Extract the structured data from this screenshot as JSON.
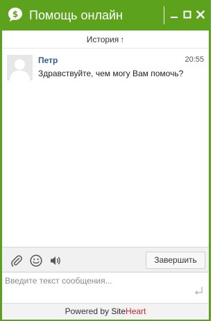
{
  "window": {
    "title": "Помощь онлайн"
  },
  "titlebar": {
    "minimize_icon": "minimize-icon",
    "maximize_icon": "maximize-icon",
    "close_icon": "close-icon",
    "logo_icon": "chat-bubble-dollar-icon"
  },
  "history": {
    "label": "История",
    "arrow": "↑"
  },
  "messages": [
    {
      "author": "Петр",
      "time": "20:55",
      "text": "Здравствуйте, чем могу Вам помочь?",
      "avatar_icon": "user-silhouette-icon"
    }
  ],
  "toolbar": {
    "icons": [
      "paperclip-icon",
      "smiley-icon",
      "speaker-icon"
    ],
    "end_label": "Завершить"
  },
  "input": {
    "placeholder": "Введите текст сообщения...",
    "value": "",
    "send_icon": "enter-icon"
  },
  "footer": {
    "prefix": "Powered by",
    "brand_part1": "Site",
    "brand_part2": "Heart"
  },
  "colors": {
    "accent": "#5ca21d",
    "author": "#2f5d94",
    "brand_heart": "#c0262c"
  }
}
